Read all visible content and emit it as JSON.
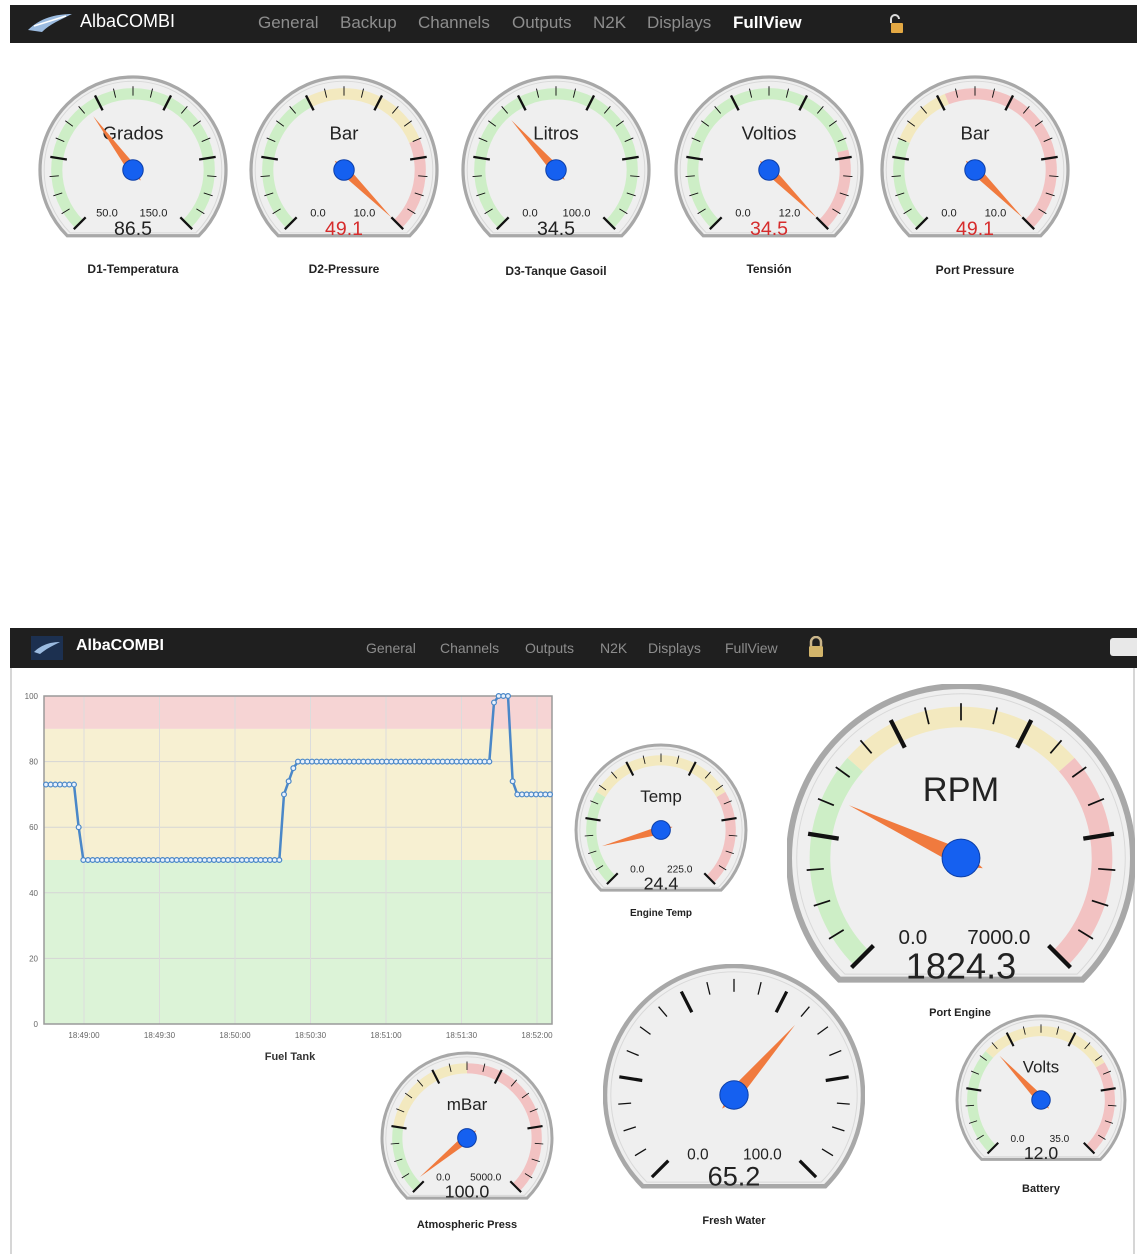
{
  "colors": {
    "nav_bg": "#1f1f1f",
    "nav_item": "#8d8d8d",
    "nav_active": "#ffffff",
    "zone_green": "#cdeec6",
    "zone_yellow": "#f3e9bf",
    "zone_red": "#f2c2c2",
    "needle": "#f07a3e",
    "hub": "#1560f0",
    "value_alarm": "#d62c2c",
    "series_line": "#4a87c8"
  },
  "top": {
    "brand": "AlbaCOMBI",
    "nav": [
      {
        "label": "General",
        "active": false
      },
      {
        "label": "Backup",
        "active": false
      },
      {
        "label": "Channels",
        "active": false
      },
      {
        "label": "Outputs",
        "active": false
      },
      {
        "label": "N2K",
        "active": false
      },
      {
        "label": "Displays",
        "active": false
      },
      {
        "label": "FullView",
        "active": true
      }
    ],
    "lock_icon": "unlock-icon",
    "gauges": [
      {
        "name": "D1-Temperatura",
        "unit": "Grados",
        "min": "50.0",
        "max": "150.0",
        "value": "86.5",
        "needle_fraction": 0.365,
        "alarm": false,
        "zones": [
          {
            "from": 0,
            "to": 1,
            "color": "green"
          }
        ]
      },
      {
        "name": "D2-Pressure",
        "unit": "Bar",
        "min": "0.0",
        "max": "10.0",
        "value": "49.1",
        "needle_fraction": 1.0,
        "alarm": true,
        "zones": [
          {
            "from": 0,
            "to": 0.4,
            "color": "green"
          },
          {
            "from": 0.4,
            "to": 0.75,
            "color": "yellow"
          },
          {
            "from": 0.75,
            "to": 1,
            "color": "red"
          }
        ]
      },
      {
        "name": "D3-Tanque Gasoil",
        "unit": "Litros",
        "min": "0.0",
        "max": "100.0",
        "value": "34.5",
        "needle_fraction": 0.345,
        "alarm": false,
        "zones": [
          {
            "from": 0,
            "to": 1,
            "color": "green"
          }
        ]
      },
      {
        "name": "Tensión",
        "unit": "Voltios",
        "min": "0.0",
        "max": "12.0",
        "value": "34.5",
        "needle_fraction": 1.0,
        "alarm": true,
        "zones": [
          {
            "from": 0,
            "to": 0.78,
            "color": "green"
          },
          {
            "from": 0.78,
            "to": 1,
            "color": "red"
          }
        ]
      },
      {
        "name": "Port Pressure",
        "unit": "Bar",
        "min": "0.0",
        "max": "10.0",
        "value": "49.1",
        "needle_fraction": 1.0,
        "alarm": true,
        "zones": [
          {
            "from": 0,
            "to": 0.25,
            "color": "green"
          },
          {
            "from": 0.25,
            "to": 0.42,
            "color": "yellow"
          },
          {
            "from": 0.42,
            "to": 1,
            "color": "red"
          }
        ]
      }
    ]
  },
  "bottom": {
    "brand": "AlbaCOMBI",
    "nav": [
      {
        "label": "General",
        "active": false
      },
      {
        "label": "Channels",
        "active": false
      },
      {
        "label": "Outputs",
        "active": false
      },
      {
        "label": "N2K",
        "active": false
      },
      {
        "label": "Displays",
        "active": false
      },
      {
        "label": "FullView",
        "active": false
      }
    ],
    "lock_icon": "lock-icon",
    "gauges": [
      {
        "name": "Engine Temp",
        "unit": "Temp",
        "min": "0.0",
        "max": "225.0",
        "value": "24.4",
        "needle_fraction": 0.11,
        "alarm": false,
        "zones": [
          {
            "from": 0,
            "to": 0.28,
            "color": "green"
          },
          {
            "from": 0.28,
            "to": 0.72,
            "color": "yellow"
          },
          {
            "from": 0.72,
            "to": 1,
            "color": "red"
          }
        ]
      },
      {
        "name": "Port Engine",
        "unit": "RPM",
        "min": "0.0",
        "max": "7000.0",
        "value": "1824.3",
        "needle_fraction": 0.26,
        "alarm": false,
        "zones": [
          {
            "from": 0,
            "to": 0.32,
            "color": "green"
          },
          {
            "from": 0.32,
            "to": 0.68,
            "color": "yellow"
          },
          {
            "from": 0.68,
            "to": 1,
            "color": "red"
          }
        ]
      },
      {
        "name": "Atmospheric Press",
        "unit": "mBar",
        "min": "0.0",
        "max": "5000.0",
        "value": "100.0",
        "needle_fraction": 0.02,
        "alarm": false,
        "zones": [
          {
            "from": 0,
            "to": 0.2,
            "color": "green"
          },
          {
            "from": 0.2,
            "to": 0.5,
            "color": "yellow"
          },
          {
            "from": 0.5,
            "to": 1,
            "color": "red"
          }
        ]
      },
      {
        "name": "Fresh Water",
        "unit": "",
        "min": "0.0",
        "max": "100.0",
        "value": "65.2",
        "needle_fraction": 0.652,
        "alarm": false,
        "zones": []
      },
      {
        "name": "Battery",
        "unit": "Volts",
        "min": "0.0",
        "max": "35.0",
        "value": "12.0",
        "needle_fraction": 0.34,
        "alarm": false,
        "zones": [
          {
            "from": 0,
            "to": 0.32,
            "color": "green"
          },
          {
            "from": 0.32,
            "to": 0.72,
            "color": "yellow"
          },
          {
            "from": 0.72,
            "to": 1,
            "color": "red"
          }
        ]
      }
    ]
  },
  "chart_data": {
    "type": "line",
    "title": "",
    "xlabel": "Fuel Tank",
    "ylabel": "",
    "ylim": [
      0,
      100
    ],
    "yticks": [
      "0",
      "20",
      "40",
      "60",
      "80",
      "100"
    ],
    "xticks": [
      "18:49:00",
      "18:49:30",
      "18:50:00",
      "18:50:30",
      "18:51:00",
      "18:51:30",
      "18:52:00"
    ],
    "bands": [
      {
        "from": 0,
        "to": 50,
        "color": "green"
      },
      {
        "from": 50,
        "to": 90,
        "color": "yellow"
      },
      {
        "from": 90,
        "to": 100,
        "color": "red"
      }
    ],
    "series": [
      {
        "values": [
          73,
          73,
          73,
          73,
          73,
          73,
          73,
          60,
          50,
          50,
          50,
          50,
          50,
          50,
          50,
          50,
          50,
          50,
          50,
          50,
          50,
          50,
          50,
          50,
          50,
          50,
          50,
          50,
          50,
          50,
          50,
          50,
          50,
          50,
          50,
          50,
          50,
          50,
          50,
          50,
          50,
          50,
          50,
          50,
          50,
          50,
          50,
          50,
          50,
          50,
          50,
          70,
          74,
          78,
          80,
          80,
          80,
          80,
          80,
          80,
          80,
          80,
          80,
          80,
          80,
          80,
          80,
          80,
          80,
          80,
          80,
          80,
          80,
          80,
          80,
          80,
          80,
          80,
          80,
          80,
          80,
          80,
          80,
          80,
          80,
          80,
          80,
          80,
          80,
          80,
          80,
          80,
          80,
          80,
          80,
          80,
          98,
          100,
          100,
          100,
          74,
          70,
          70,
          70,
          70,
          70,
          70,
          70,
          70
        ]
      }
    ]
  }
}
